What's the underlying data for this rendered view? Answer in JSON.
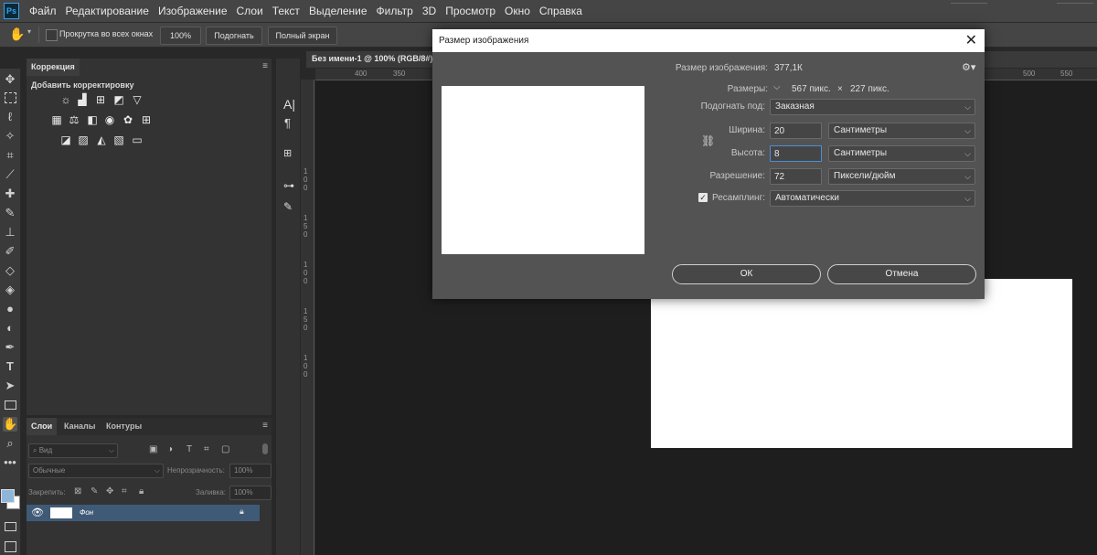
{
  "app": {
    "logo": "Ps"
  },
  "menu": [
    "Файл",
    "Редактирование",
    "Изображение",
    "Слои",
    "Текст",
    "Выделение",
    "Фильтр",
    "3D",
    "Просмотр",
    "Окно",
    "Справка"
  ],
  "options_bar": {
    "scroll_all_windows": "Прокрутка во всех окнах",
    "zoom": "100%",
    "fit_button": "Подогнать",
    "fullscreen_button": "Полный экран"
  },
  "correction_panel": {
    "tab": "Коррекция",
    "heading": "Добавить корректировку"
  },
  "layers_panel": {
    "tabs": [
      "Слои",
      "Каналы",
      "Контуры"
    ],
    "search_placeholder": "Вид",
    "blend_mode": "Обычные",
    "opacity_label": "Непрозрачность:",
    "opacity_value": "100%",
    "lock_label": "Закрепить:",
    "fill_label": "Заливка:",
    "fill_value": "100%",
    "layer_name": "Фон"
  },
  "document": {
    "tab_title": "Без имени-1 @ 100% (RGB/8#)",
    "ruler_ticks_top": [
      "400",
      "350",
      "500",
      "550"
    ],
    "ruler_ticks_left": [
      "1",
      "0",
      "0",
      "1",
      "5",
      "0",
      "1",
      "0",
      "0",
      "1",
      "5",
      "0",
      "1",
      "0",
      "0"
    ]
  },
  "dialog": {
    "title": "Размер изображения",
    "image_size_label": "Размер изображения:",
    "image_size_value": "377,1К",
    "dimensions_label": "Размеры:",
    "dimensions_w": "567 пикс.",
    "dimensions_x": "×",
    "dimensions_h": "227 пикс.",
    "fit_to_label": "Подогнать под:",
    "fit_to_value": "Заказная",
    "width_label": "Ширина:",
    "width_value": "20",
    "width_unit": "Сантиметры",
    "height_label": "Высота:",
    "height_value": "8",
    "height_unit": "Сантиметры",
    "resolution_label": "Разрешение:",
    "resolution_value": "72",
    "resolution_unit": "Пиксели/дюйм",
    "resample_label": "Ресамплинг:",
    "resample_value": "Автоматически",
    "ok": "ОК",
    "cancel": "Отмена"
  },
  "colors": {
    "foreground": "#8fb6d8",
    "background": "#ffffff",
    "logo_accent": "#3aa0e8"
  }
}
